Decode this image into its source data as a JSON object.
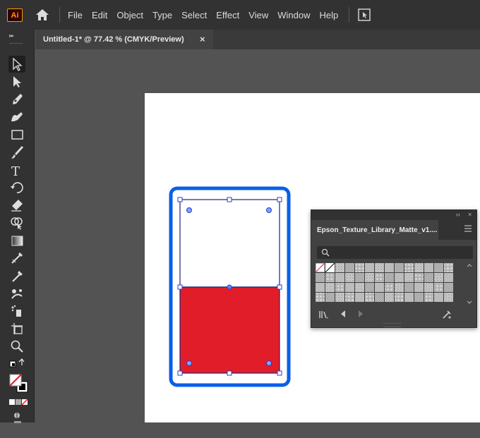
{
  "app": {
    "logo": "Ai"
  },
  "menu": [
    "File",
    "Edit",
    "Object",
    "Type",
    "Select",
    "Effect",
    "View",
    "Window",
    "Help"
  ],
  "document_tab": {
    "title": "Untitled-1* @ 77.42 % (CMYK/Preview)",
    "close": "×"
  },
  "swatch_panel": {
    "tab_title": "Epson_Texture_Library_Matte_v1....",
    "collapse": "‹‹",
    "close": "×"
  },
  "colors": {
    "ui_dark": "#323232",
    "canvas_bg": "#535353",
    "artboard": "#ffffff",
    "red_fill": "#e11d2a",
    "selection_highlight": "#0a5fe8",
    "selection_path": "#1a237e"
  },
  "tools": [
    "selection-tool",
    "direct-selection-tool",
    "pen-tool",
    "curvature-tool",
    "rectangle-tool",
    "paintbrush-tool",
    "type-tool",
    "rotate-tool",
    "eraser-tool",
    "shape-builder-tool",
    "gradient-tool",
    "eyedropper-paint-tool",
    "eyedropper-tool",
    "blend-tool",
    "symbol-sprayer-tool",
    "artboard-tool",
    "zoom-tool",
    "swap-fill-stroke",
    "fill-stroke-indicator",
    "color-mode-buttons",
    "change-screen-mode"
  ]
}
